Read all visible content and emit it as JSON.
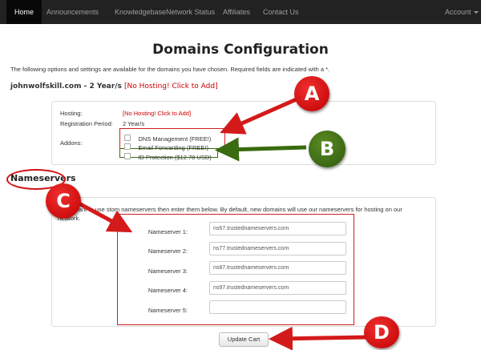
{
  "nav": {
    "items": [
      {
        "label": "Home",
        "active": true
      },
      {
        "label": "Announcements"
      },
      {
        "label": "Knowledgebase"
      },
      {
        "label": "Network Status"
      },
      {
        "label": "Affiliates"
      },
      {
        "label": "Contact Us"
      }
    ],
    "account_label": "Account"
  },
  "page": {
    "title": "Domains Configuration",
    "intro": "The following options and settings are available for the domains you have chosen. Required fields are indicated with a *."
  },
  "domain": {
    "name_period": "johnwolfskill.com - 2 Year/s",
    "no_hosting": "[No Hosting! Click to Add]"
  },
  "config": {
    "hosting_label": "Hosting:",
    "hosting_value": "[No Hosting! Click to Add]",
    "period_label": "Registration Period:",
    "period_value": "2 Year/s",
    "addons_label": "Addons:",
    "addons": [
      {
        "label": "DNS Management (FREE!)",
        "checked": false
      },
      {
        "label": "Email Forwarding (FREE!)",
        "checked": false
      },
      {
        "label": "ID Protection ($12.78 USD)",
        "checked": false
      }
    ]
  },
  "nameservers": {
    "heading": "Nameservers",
    "desc_start": "If you want to use",
    "desc_end": "stom nameservers then enter them below. By default, new domains will use our nameservers for hosting on our network.",
    "fields": [
      {
        "label": "Nameserver 1:",
        "value": "ns67.trustednameservers.com"
      },
      {
        "label": "Nameserver 2:",
        "value": "ns77.trustednameservers.com"
      },
      {
        "label": "Nameserver 3:",
        "value": "ns87.trustednameservers.com"
      },
      {
        "label": "Nameserver 4:",
        "value": "ns97.trustednameservers.com"
      },
      {
        "label": "Nameserver 5:",
        "value": ""
      }
    ]
  },
  "update_button": "Update Cart",
  "callouts": {
    "a": "A",
    "b": "B",
    "c": "C",
    "d": "D"
  },
  "colors": {
    "annotation_red": "#d02020",
    "annotation_green": "#3a6b10",
    "link_red": "#cc0000",
    "navbar": "#222222"
  }
}
